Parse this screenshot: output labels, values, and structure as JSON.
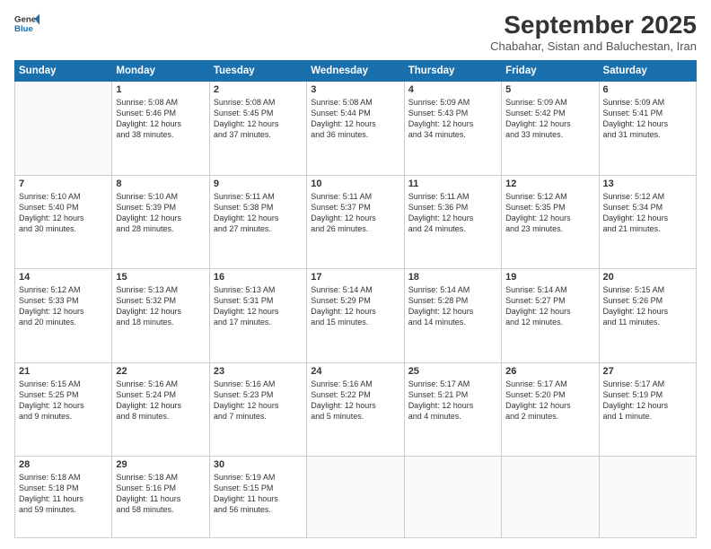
{
  "header": {
    "logo_line1": "General",
    "logo_line2": "Blue",
    "month_title": "September 2025",
    "subtitle": "Chabahar, Sistan and Baluchestan, Iran"
  },
  "weekdays": [
    "Sunday",
    "Monday",
    "Tuesday",
    "Wednesday",
    "Thursday",
    "Friday",
    "Saturday"
  ],
  "weeks": [
    [
      {
        "day": "",
        "info": ""
      },
      {
        "day": "1",
        "info": "Sunrise: 5:08 AM\nSunset: 5:46 PM\nDaylight: 12 hours\nand 38 minutes."
      },
      {
        "day": "2",
        "info": "Sunrise: 5:08 AM\nSunset: 5:45 PM\nDaylight: 12 hours\nand 37 minutes."
      },
      {
        "day": "3",
        "info": "Sunrise: 5:08 AM\nSunset: 5:44 PM\nDaylight: 12 hours\nand 36 minutes."
      },
      {
        "day": "4",
        "info": "Sunrise: 5:09 AM\nSunset: 5:43 PM\nDaylight: 12 hours\nand 34 minutes."
      },
      {
        "day": "5",
        "info": "Sunrise: 5:09 AM\nSunset: 5:42 PM\nDaylight: 12 hours\nand 33 minutes."
      },
      {
        "day": "6",
        "info": "Sunrise: 5:09 AM\nSunset: 5:41 PM\nDaylight: 12 hours\nand 31 minutes."
      }
    ],
    [
      {
        "day": "7",
        "info": "Sunrise: 5:10 AM\nSunset: 5:40 PM\nDaylight: 12 hours\nand 30 minutes."
      },
      {
        "day": "8",
        "info": "Sunrise: 5:10 AM\nSunset: 5:39 PM\nDaylight: 12 hours\nand 28 minutes."
      },
      {
        "day": "9",
        "info": "Sunrise: 5:11 AM\nSunset: 5:38 PM\nDaylight: 12 hours\nand 27 minutes."
      },
      {
        "day": "10",
        "info": "Sunrise: 5:11 AM\nSunset: 5:37 PM\nDaylight: 12 hours\nand 26 minutes."
      },
      {
        "day": "11",
        "info": "Sunrise: 5:11 AM\nSunset: 5:36 PM\nDaylight: 12 hours\nand 24 minutes."
      },
      {
        "day": "12",
        "info": "Sunrise: 5:12 AM\nSunset: 5:35 PM\nDaylight: 12 hours\nand 23 minutes."
      },
      {
        "day": "13",
        "info": "Sunrise: 5:12 AM\nSunset: 5:34 PM\nDaylight: 12 hours\nand 21 minutes."
      }
    ],
    [
      {
        "day": "14",
        "info": "Sunrise: 5:12 AM\nSunset: 5:33 PM\nDaylight: 12 hours\nand 20 minutes."
      },
      {
        "day": "15",
        "info": "Sunrise: 5:13 AM\nSunset: 5:32 PM\nDaylight: 12 hours\nand 18 minutes."
      },
      {
        "day": "16",
        "info": "Sunrise: 5:13 AM\nSunset: 5:31 PM\nDaylight: 12 hours\nand 17 minutes."
      },
      {
        "day": "17",
        "info": "Sunrise: 5:14 AM\nSunset: 5:29 PM\nDaylight: 12 hours\nand 15 minutes."
      },
      {
        "day": "18",
        "info": "Sunrise: 5:14 AM\nSunset: 5:28 PM\nDaylight: 12 hours\nand 14 minutes."
      },
      {
        "day": "19",
        "info": "Sunrise: 5:14 AM\nSunset: 5:27 PM\nDaylight: 12 hours\nand 12 minutes."
      },
      {
        "day": "20",
        "info": "Sunrise: 5:15 AM\nSunset: 5:26 PM\nDaylight: 12 hours\nand 11 minutes."
      }
    ],
    [
      {
        "day": "21",
        "info": "Sunrise: 5:15 AM\nSunset: 5:25 PM\nDaylight: 12 hours\nand 9 minutes."
      },
      {
        "day": "22",
        "info": "Sunrise: 5:16 AM\nSunset: 5:24 PM\nDaylight: 12 hours\nand 8 minutes."
      },
      {
        "day": "23",
        "info": "Sunrise: 5:16 AM\nSunset: 5:23 PM\nDaylight: 12 hours\nand 7 minutes."
      },
      {
        "day": "24",
        "info": "Sunrise: 5:16 AM\nSunset: 5:22 PM\nDaylight: 12 hours\nand 5 minutes."
      },
      {
        "day": "25",
        "info": "Sunrise: 5:17 AM\nSunset: 5:21 PM\nDaylight: 12 hours\nand 4 minutes."
      },
      {
        "day": "26",
        "info": "Sunrise: 5:17 AM\nSunset: 5:20 PM\nDaylight: 12 hours\nand 2 minutes."
      },
      {
        "day": "27",
        "info": "Sunrise: 5:17 AM\nSunset: 5:19 PM\nDaylight: 12 hours\nand 1 minute."
      }
    ],
    [
      {
        "day": "28",
        "info": "Sunrise: 5:18 AM\nSunset: 5:18 PM\nDaylight: 11 hours\nand 59 minutes."
      },
      {
        "day": "29",
        "info": "Sunrise: 5:18 AM\nSunset: 5:16 PM\nDaylight: 11 hours\nand 58 minutes."
      },
      {
        "day": "30",
        "info": "Sunrise: 5:19 AM\nSunset: 5:15 PM\nDaylight: 11 hours\nand 56 minutes."
      },
      {
        "day": "",
        "info": ""
      },
      {
        "day": "",
        "info": ""
      },
      {
        "day": "",
        "info": ""
      },
      {
        "day": "",
        "info": ""
      }
    ]
  ]
}
